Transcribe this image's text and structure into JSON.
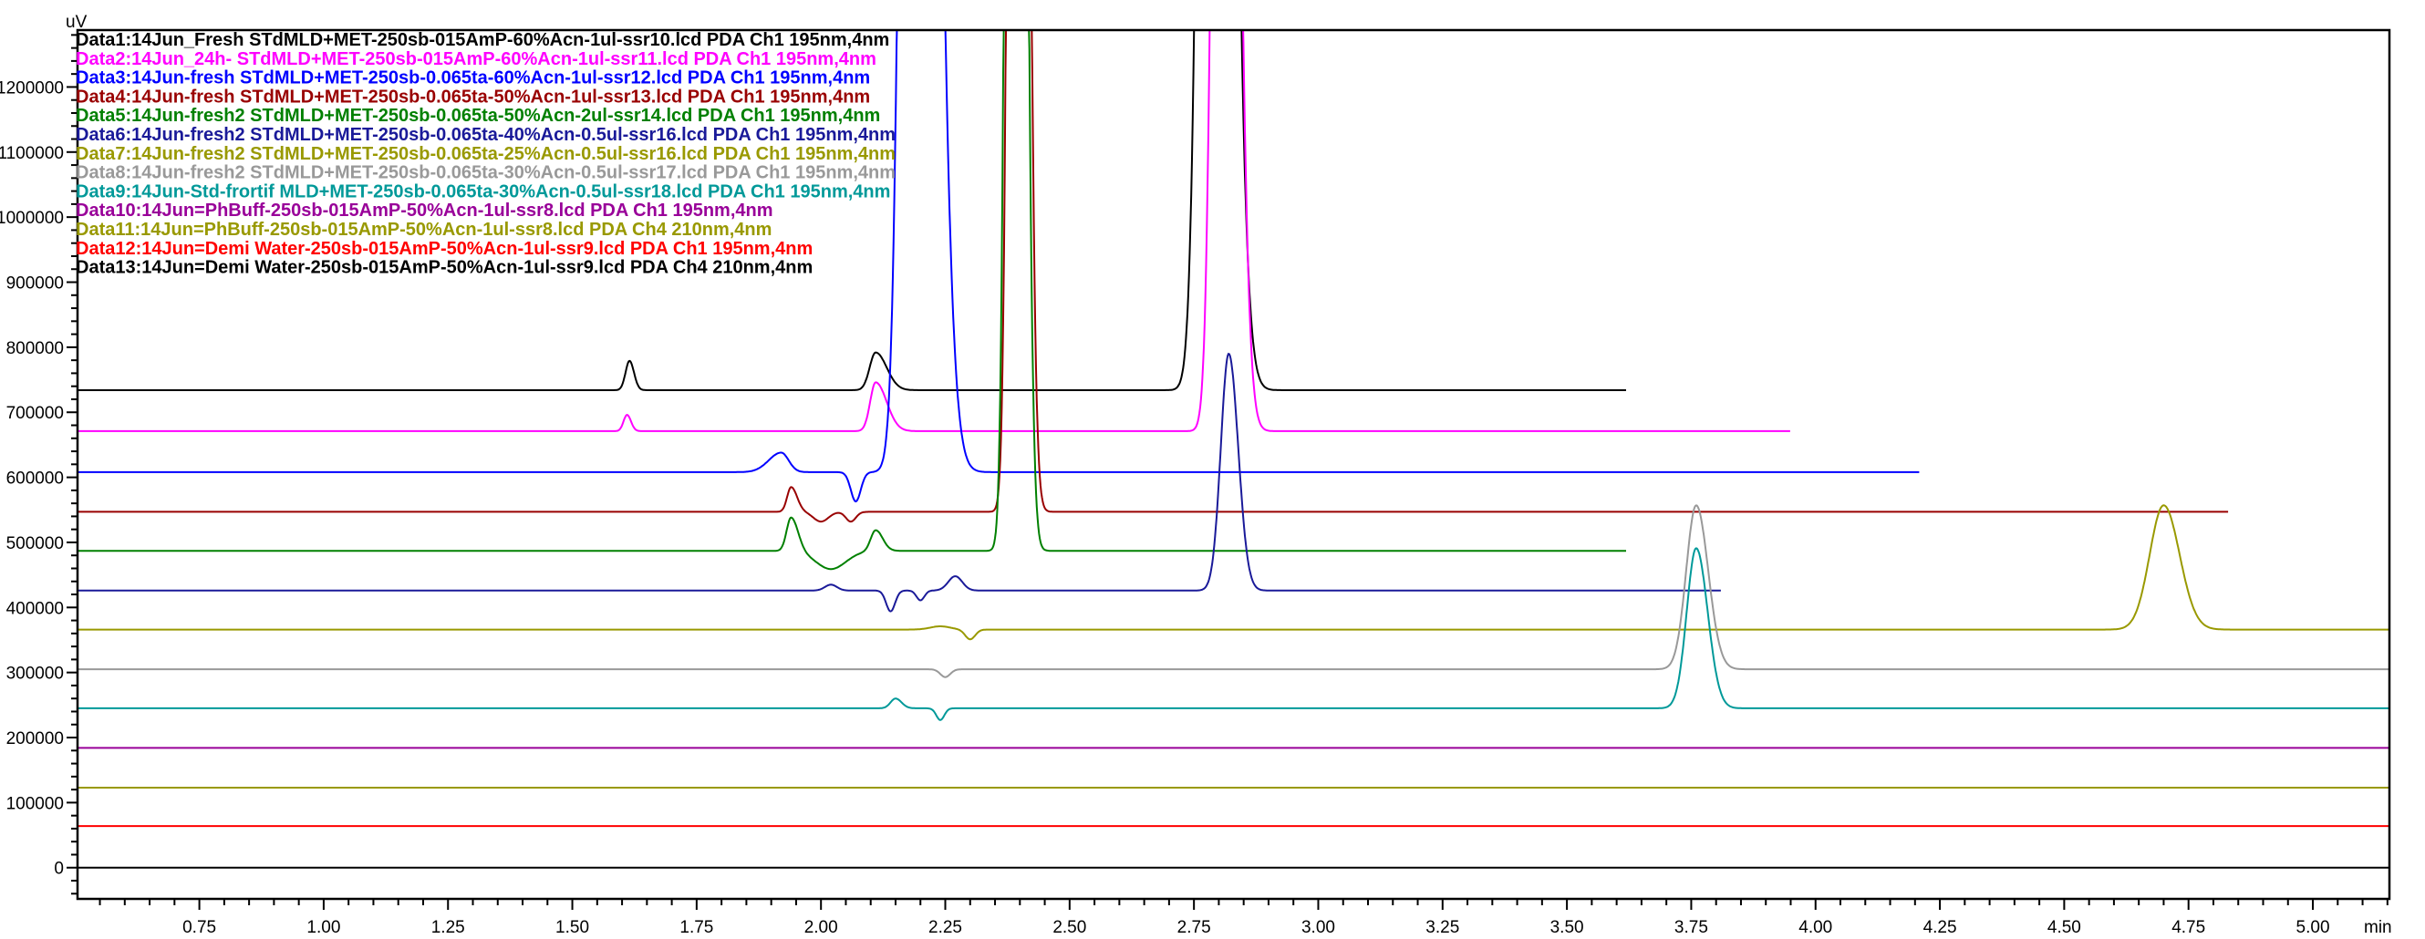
{
  "chart_data": {
    "type": "line",
    "title": "",
    "xlabel": "min",
    "ylabel": "uV",
    "xlim": [
      0.505,
      5.154
    ],
    "ylim": [
      -48000,
      1287500
    ],
    "x_ticks": [
      "0.75",
      "1.00",
      "1.25",
      "1.50",
      "1.75",
      "2.00",
      "2.25",
      "2.50",
      "2.75",
      "3.00",
      "3.25",
      "3.50",
      "3.75",
      "4.00",
      "4.25",
      "4.50",
      "4.75",
      "5.00"
    ],
    "y_ticks": [
      "0",
      "100000",
      "200000",
      "300000",
      "400000",
      "500000",
      "600000",
      "700000",
      "800000",
      "900000",
      "1000000",
      "1100000",
      "1200000"
    ],
    "grid": false,
    "legend_position": "top-left",
    "series": [
      {
        "name": "Data1:14Jun_Fresh STdMLD+MET-250sb-015AmP-60%Acn-1ul-ssr10.lcd PDA Ch1 195nm,4nm",
        "color": "#000000",
        "baseline": 734000,
        "end": 3.62,
        "peaks": [
          [
            1.615,
            45000,
            0.008,
            0.009
          ],
          [
            2.11,
            58000,
            0.012,
            0.022
          ],
          [
            2.79,
            4000000,
            0.02,
            0.028
          ]
        ]
      },
      {
        "name": "Data2:14Jun_24h- STdMLD+MET-250sb-015AmP-60%Acn-1ul-ssr11.lcd PDA Ch1 195nm,4nm",
        "color": "#ff00ff",
        "baseline": 671000,
        "end": 3.95,
        "peaks": [
          [
            1.61,
            25000,
            0.007,
            0.008
          ],
          [
            2.11,
            75000,
            0.011,
            0.022
          ],
          [
            2.81,
            3000000,
            0.016,
            0.022
          ]
        ]
      },
      {
        "name": "Data3:14Jun-fresh  STdMLD+MET-250sb-0.065ta-60%Acn-1ul-ssr12.lcd PDA Ch1 195nm,4nm",
        "color": "#0000ff",
        "baseline": 608000,
        "end": 4.21,
        "peaks": [
          [
            1.92,
            30000,
            0.025,
            0.015
          ],
          [
            2.07,
            -45000,
            0.01,
            0.01
          ],
          [
            2.19,
            4000000,
            0.02,
            0.032
          ]
        ]
      },
      {
        "name": "Data4:14Jun-fresh  STdMLD+MET-250sb-0.065ta-50%Acn-1ul-ssr13.lcd PDA Ch1 195nm,4nm",
        "color": "#990000",
        "baseline": 547000,
        "end": 4.83,
        "peaks": [
          [
            1.94,
            38000,
            0.008,
            0.012
          ],
          [
            2.0,
            -15000,
            0.015,
            0.015
          ],
          [
            2.06,
            -15000,
            0.01,
            0.01
          ],
          [
            2.395,
            5000000,
            0.012,
            0.015
          ]
        ]
      },
      {
        "name": "Data5:14Jun-fresh2  STdMLD+MET-250sb-0.065ta-50%Acn-2ul-ssr14.lcd PDA Ch1 195nm,4nm",
        "color": "#008000",
        "baseline": 487000,
        "end": 3.62,
        "peaks": [
          [
            1.94,
            52000,
            0.009,
            0.014
          ],
          [
            2.02,
            -28000,
            0.03,
            0.03
          ],
          [
            2.11,
            32000,
            0.01,
            0.014
          ],
          [
            2.39,
            5000000,
            0.012,
            0.015
          ]
        ]
      },
      {
        "name": "Data6:14Jun-fresh2  STdMLD+MET-250sb-0.065ta-40%Acn-0.5ul-ssr16.lcd PDA Ch1 195nm,4nm",
        "color": "#1a1a99",
        "baseline": 426000,
        "end": 3.81,
        "peaks": [
          [
            2.02,
            9000,
            0.012,
            0.012
          ],
          [
            2.14,
            -32000,
            0.009,
            0.009
          ],
          [
            2.2,
            -15000,
            0.008,
            0.008
          ],
          [
            2.27,
            22000,
            0.014,
            0.014
          ],
          [
            2.82,
            364000,
            0.016,
            0.019
          ]
        ]
      },
      {
        "name": "Data7:14Jun-fresh2  STdMLD+MET-250sb-0.065ta-25%Acn-0.5ul-ssr16.lcd PDA Ch1 195nm,4nm",
        "color": "#999900",
        "baseline": 366000,
        "end": 5.154,
        "peaks": [
          [
            2.24,
            5000,
            0.02,
            0.02
          ],
          [
            2.3,
            -15000,
            0.01,
            0.01
          ],
          [
            4.7,
            191000,
            0.028,
            0.032
          ]
        ]
      },
      {
        "name": "Data8:14Jun-fresh2  STdMLD+MET-250sb-0.065ta-30%Acn-0.5ul-ssr17.lcd PDA Ch1 195nm,4nm",
        "color": "#999999",
        "baseline": 305000,
        "end": 5.154,
        "peaks": [
          [
            2.25,
            -12000,
            0.01,
            0.01
          ],
          [
            3.76,
            252000,
            0.02,
            0.024
          ]
        ]
      },
      {
        "name": "Data9:14Jun-Std-frortif  MLD+MET-250sb-0.065ta-30%Acn-0.5ul-ssr18.lcd PDA Ch1 195nm,4nm",
        "color": "#009999",
        "baseline": 245000,
        "end": 5.154,
        "peaks": [
          [
            2.15,
            15000,
            0.01,
            0.012
          ],
          [
            2.24,
            -18000,
            0.008,
            0.008
          ],
          [
            3.76,
            246000,
            0.019,
            0.023
          ]
        ]
      },
      {
        "name": "Data10:14Jun=PhBuff-250sb-015AmP-50%Acn-1ul-ssr8.lcd PDA Ch1 195nm,4nm",
        "color": "#990099",
        "baseline": 184000,
        "end": 5.154,
        "peaks": []
      },
      {
        "name": "Data11:14Jun=PhBuff-250sb-015AmP-50%Acn-1ul-ssr8.lcd PDA Ch4 210nm,4nm",
        "color": "#999900",
        "baseline": 123000,
        "end": 5.154,
        "peaks": []
      },
      {
        "name": "Data12:14Jun=Demi Water-250sb-015AmP-50%Acn-1ul-ssr9.lcd PDA Ch1 195nm,4nm",
        "color": "#ff0000",
        "baseline": 64000,
        "end": 5.154,
        "peaks": []
      },
      {
        "name": "Data13:14Jun=Demi Water-250sb-015AmP-50%Acn-1ul-ssr9.lcd PDA Ch4 210nm,4nm",
        "color": "#000000",
        "baseline": 0,
        "end": 5.154,
        "peaks": []
      }
    ]
  }
}
